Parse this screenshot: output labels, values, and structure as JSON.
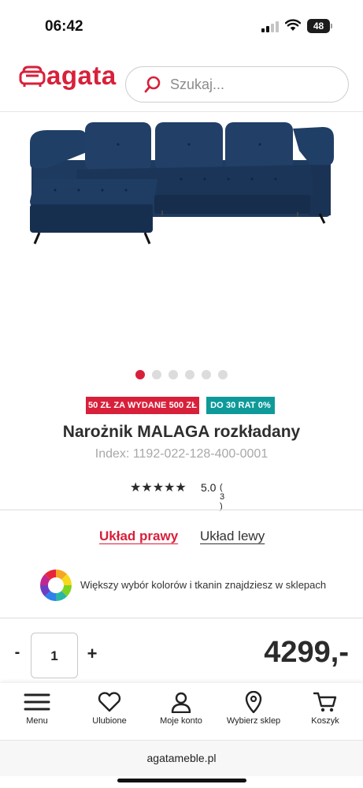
{
  "status_bar": {
    "time": "06:42",
    "battery": "48"
  },
  "header": {
    "logo_text": "agata",
    "search_placeholder": "Szukaj...",
    "search_icon": "search-icon"
  },
  "carousel": {
    "total": 6,
    "active": 0
  },
  "badges": {
    "promo": "50 ZŁ ZA WYDANE 500 ZŁ",
    "installments": "DO 30 RAT 0%"
  },
  "colors": {
    "brand_red": "#d8203a",
    "teal": "#0f9a9a",
    "sofa_blue": "#1d3556"
  },
  "product": {
    "title": "Narożnik MALAGA rozkładany",
    "index": "Index: 1192-022-128-400-0001",
    "rating_value": 5.0,
    "rating_label": "5.0",
    "rating_count": "( 3 )",
    "stars": "★★★★★"
  },
  "layout_options": {
    "right": "Układ prawy",
    "left": "Układ lewy"
  },
  "color_info": {
    "text": "Większy wybór kolorów i tkanin znajdziesz w sklepach",
    "icon": "color-wheel-icon"
  },
  "purchase": {
    "minus": "-",
    "quantity": "1",
    "plus": "+",
    "price": "4299,-"
  },
  "bottom_nav": {
    "menu": "Menu",
    "favorites": "Ulubione",
    "account": "Moje konto",
    "store": "Wybierz sklep",
    "cart": "Koszyk"
  },
  "browser": {
    "url": "agatameble.pl"
  }
}
